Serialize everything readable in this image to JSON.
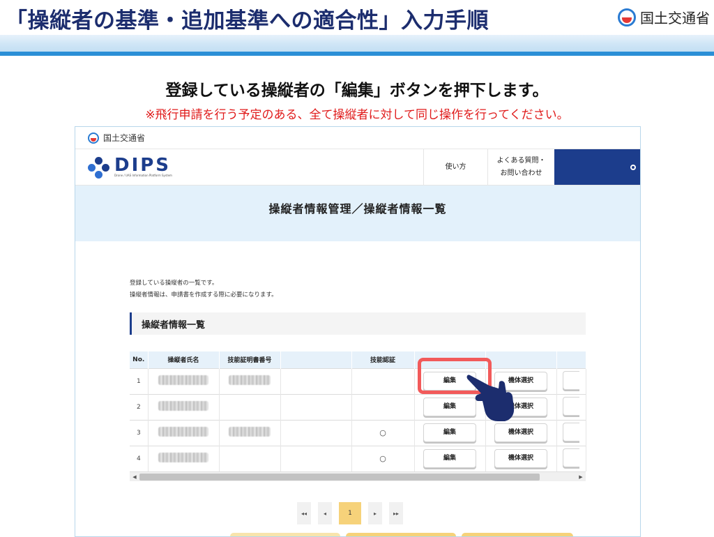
{
  "slide": {
    "title": "「操縦者の基準・追加基準への適合性」入力手順",
    "org_label": "国土交通省",
    "instruction": "登録している操縦者の「編集」ボタンを押下します。",
    "note": "※飛行申請を行う予定のある、全て操縦者に対して同じ操作を行ってください。"
  },
  "app": {
    "gov_label": "国土交通省",
    "logo_text": "DIPS",
    "logo_subtitle": "Drone / UAS Information Platform System",
    "nav": {
      "usage": "使い方",
      "faq_line1": "よくある質問・",
      "faq_line2": "お問い合わせ"
    },
    "page_title": "操縦者情報管理／操縦者情報一覧",
    "desc_line1": "登録している操縦者の一覧です。",
    "desc_line2": "操縦者情報は、申請書を作成する際に必要になります。",
    "section_title": "操縦者情報一覧",
    "table": {
      "headers": [
        "No.",
        "操縦者氏名",
        "技能証明書番号",
        "",
        "技能認証",
        "",
        "",
        ""
      ],
      "rows": [
        {
          "no": "1",
          "cert_mark": "",
          "has_cert_no": true
        },
        {
          "no": "2",
          "cert_mark": "",
          "has_cert_no": false
        },
        {
          "no": "3",
          "cert_mark": "○",
          "has_cert_no": true
        },
        {
          "no": "4",
          "cert_mark": "○",
          "has_cert_no": false
        }
      ],
      "edit_label": "編集",
      "select_aircraft_label": "機体選択"
    },
    "pager": {
      "first": "◂◂",
      "prev": "◂",
      "current": "1",
      "next": "▸",
      "last": "▸▸"
    }
  },
  "colors": {
    "title": "#1c2d6e",
    "note_red": "#e01b1b",
    "dips_blue": "#1c3d8c",
    "highlight": "#f25a5a",
    "pager_active": "#f6d27a"
  },
  "icons": {
    "hand": "pointing-hand-icon",
    "scroll_left": "scroll-left-icon",
    "scroll_right": "scroll-right-icon"
  }
}
